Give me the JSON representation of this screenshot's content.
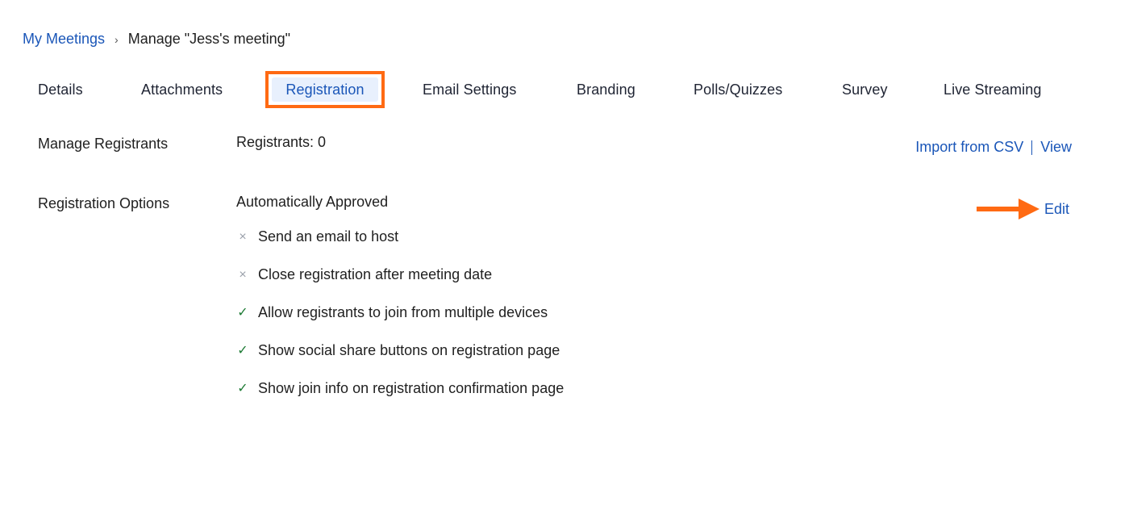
{
  "breadcrumb": {
    "parent": "My Meetings",
    "separator": "›",
    "current": "Manage \"Jess's meeting\""
  },
  "tabs": [
    {
      "label": "Details",
      "active": false
    },
    {
      "label": "Attachments",
      "active": false
    },
    {
      "label": "Registration",
      "active": true
    },
    {
      "label": "Email Settings",
      "active": false
    },
    {
      "label": "Branding",
      "active": false
    },
    {
      "label": "Polls/Quizzes",
      "active": false
    },
    {
      "label": "Survey",
      "active": false
    },
    {
      "label": "Live Streaming",
      "active": false
    }
  ],
  "manage_registrants": {
    "label": "Manage Registrants",
    "count_text": "Registrants: 0",
    "import_label": "Import from CSV",
    "view_label": "View"
  },
  "registration_options": {
    "label": "Registration Options",
    "approval": "Automatically Approved",
    "edit_label": "Edit",
    "items": [
      {
        "text": "Send an email to host",
        "enabled": false,
        "icon": "×"
      },
      {
        "text": "Close registration after meeting date",
        "enabled": false,
        "icon": "×"
      },
      {
        "text": "Allow registrants to join from multiple devices",
        "enabled": true,
        "icon": "✓"
      },
      {
        "text": "Show social share buttons on registration page",
        "enabled": true,
        "icon": "✓"
      },
      {
        "text": "Show join info on registration confirmation page",
        "enabled": true,
        "icon": "✓"
      }
    ]
  },
  "colors": {
    "link": "#1a56b8",
    "highlight_border": "#ff6a13",
    "active_tab_bg": "#e8f0fd",
    "check": "#1e7b35",
    "cross": "#9aa0aa"
  }
}
